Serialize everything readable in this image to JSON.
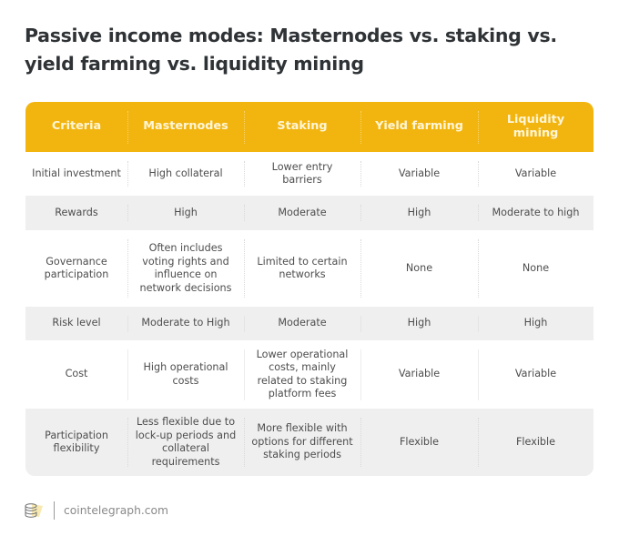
{
  "title": "Passive income modes: Masternodes vs. staking vs. yield farming vs. liquidity mining",
  "table": {
    "headers": [
      "Criteria",
      "Masternodes",
      "Staking",
      "Yield farming",
      "Liquidity mining"
    ],
    "rows": [
      [
        "Initial investment",
        "High collateral",
        "Lower entry barriers",
        "Variable",
        "Variable"
      ],
      [
        "Rewards",
        "High",
        "Moderate",
        "High",
        "Moderate to high"
      ],
      [
        "Governance participation",
        "Often includes voting rights and influence on network decisions",
        "Limited to certain networks",
        "None",
        "None"
      ],
      [
        "Risk level",
        "Moderate to High",
        "Moderate",
        "High",
        "High"
      ],
      [
        "Cost",
        "High operational costs",
        "Lower operational costs, mainly related to staking platform fees",
        "Variable",
        "Variable"
      ],
      [
        "Participation flexibility",
        "Less flexible due to lock-up periods and collateral requirements",
        "More flexible with options for different staking periods",
        "Flexible",
        "Flexible"
      ]
    ]
  },
  "footer": {
    "logo_icon": "coin-stack-icon",
    "site": "cointelegraph.com"
  },
  "colors": {
    "header_bg": "#f2b50f",
    "header_text": "#fff6d8",
    "row_alt": "#efefef",
    "title": "#2f3336"
  }
}
